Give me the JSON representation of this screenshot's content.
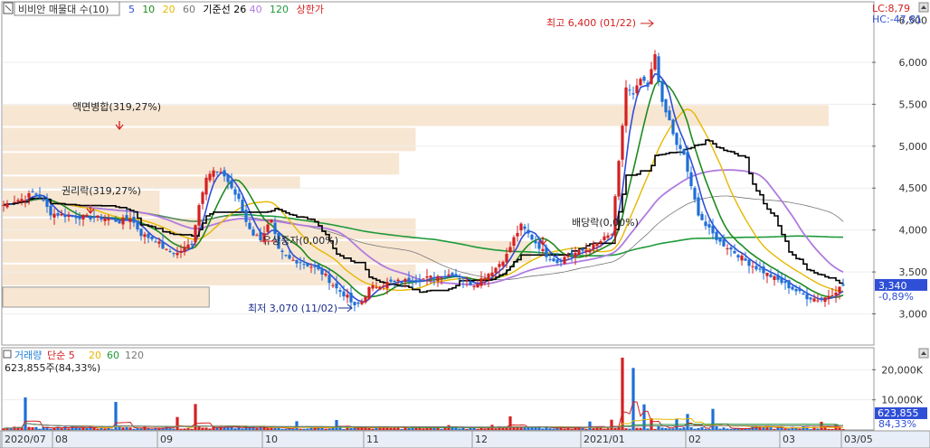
{
  "header": {
    "indicator_name": "비비안 매물대 수(10)",
    "ma": [
      {
        "label": "5",
        "color": "#2f4fd6"
      },
      {
        "label": "10",
        "color": "#1f8a1f"
      },
      {
        "label": "20",
        "color": "#e6b800"
      },
      {
        "label": "60",
        "color": "#777777"
      },
      {
        "label": "기준선 26",
        "color": "#000000"
      },
      {
        "label": "40",
        "color": "#b07be0"
      },
      {
        "label": "120",
        "color": "#1e9a3a"
      },
      {
        "label": "상한가",
        "color": "#d42020"
      }
    ],
    "lc_label": "LC:8,79",
    "hc_label": "HC:-47,81"
  },
  "volume_header": {
    "items": [
      {
        "label": "거래량",
        "color": "#1f7fd6"
      },
      {
        "label": "단순 5",
        "color": "#d42020"
      },
      {
        "label": "20",
        "color": "#e6b800"
      },
      {
        "label": "60",
        "color": "#1e9a3a"
      },
      {
        "label": "120",
        "color": "#777777"
      }
    ],
    "value_line": "623,855주(84,33%)"
  },
  "annotations": {
    "high": "최고 6,400 (01/22)",
    "low": "최저 3,070 (11/02)",
    "events": [
      "액면병합(319,27%)",
      "권리락(319,27%)",
      "유상증자(0,00%)",
      "배당락(0,00%)"
    ]
  },
  "current": {
    "price_tag": "3,340",
    "change_tag": "-0,89%",
    "volume_tag": "623,855",
    "volume_pct_tag": "84,33%"
  },
  "colors": {
    "up": "#d42020",
    "down": "#1f6fd6",
    "volume_profile": "#f7e6d2",
    "tag_bg": "#2f4fd6"
  },
  "chart_data": {
    "type": "candlestick",
    "price_axis": {
      "ylim": [
        2650,
        6700
      ],
      "ticks": [
        3000,
        3500,
        4000,
        4500,
        5000,
        5500,
        6000
      ],
      "tick_labels": [
        "3,000",
        "3,500",
        "4,000",
        "4,500",
        "5,000",
        "5,500",
        "6,000"
      ]
    },
    "volume_axis": {
      "ylim": [
        0,
        27000000
      ],
      "ticks": [
        10000000,
        20000000
      ],
      "tick_labels": [
        "10,000K",
        "20,000K"
      ]
    },
    "x_axis": {
      "labels": [
        "2020/07",
        "08",
        "09",
        "10",
        "11",
        "12",
        "2021/01",
        "02",
        "03",
        "03/05"
      ],
      "label_positions": [
        0,
        14,
        43,
        72,
        100,
        130,
        160,
        189,
        215,
        232
      ]
    },
    "price_path": [
      [
        0,
        4300
      ],
      [
        3,
        4350
      ],
      [
        6,
        4380
      ],
      [
        8,
        4450
      ],
      [
        10,
        4400
      ],
      [
        13,
        4200
      ],
      [
        16,
        4180
      ],
      [
        20,
        4160
      ],
      [
        24,
        4150
      ],
      [
        28,
        4140
      ],
      [
        32,
        4100
      ],
      [
        35,
        4150
      ],
      [
        38,
        3950
      ],
      [
        42,
        3880
      ],
      [
        45,
        3750
      ],
      [
        48,
        3720
      ],
      [
        52,
        3850
      ],
      [
        54,
        4300
      ],
      [
        56,
        4650
      ],
      [
        58,
        4700
      ],
      [
        61,
        4650
      ],
      [
        63,
        4500
      ],
      [
        65,
        4350
      ],
      [
        67,
        4100
      ],
      [
        69,
        3950
      ],
      [
        71,
        3900
      ],
      [
        73,
        4050
      ],
      [
        74,
        4100
      ],
      [
        76,
        3750
      ],
      [
        79,
        3650
      ],
      [
        82,
        3620
      ],
      [
        86,
        3550
      ],
      [
        89,
        3450
      ],
      [
        92,
        3300
      ],
      [
        95,
        3200
      ],
      [
        97,
        3080
      ],
      [
        99,
        3150
      ],
      [
        101,
        3300
      ],
      [
        104,
        3350
      ],
      [
        108,
        3380
      ],
      [
        112,
        3400
      ],
      [
        116,
        3420
      ],
      [
        120,
        3450
      ],
      [
        124,
        3480
      ],
      [
        127,
        3400
      ],
      [
        130,
        3350
      ],
      [
        133,
        3450
      ],
      [
        136,
        3550
      ],
      [
        139,
        3700
      ],
      [
        141,
        3900
      ],
      [
        143,
        4050
      ],
      [
        145,
        3950
      ],
      [
        147,
        3850
      ],
      [
        150,
        3700
      ],
      [
        153,
        3620
      ],
      [
        156,
        3700
      ],
      [
        160,
        3750
      ],
      [
        163,
        3800
      ],
      [
        166,
        3900
      ],
      [
        168,
        3950
      ],
      [
        170,
        4800
      ],
      [
        172,
        5700
      ],
      [
        174,
        5600
      ],
      [
        176,
        5800
      ],
      [
        178,
        5700
      ],
      [
        180,
        6100
      ],
      [
        182,
        5500
      ],
      [
        184,
        5300
      ],
      [
        186,
        5000
      ],
      [
        188,
        4900
      ],
      [
        190,
        4500
      ],
      [
        192,
        4200
      ],
      [
        194,
        4050
      ],
      [
        196,
        3950
      ],
      [
        198,
        3850
      ],
      [
        200,
        3800
      ],
      [
        203,
        3700
      ],
      [
        206,
        3600
      ],
      [
        210,
        3500
      ],
      [
        214,
        3400
      ],
      [
        218,
        3300
      ],
      [
        222,
        3200
      ],
      [
        226,
        3170
      ],
      [
        229,
        3250
      ],
      [
        232,
        3340
      ]
    ],
    "volume_spikes": [
      [
        6,
        10800000
      ],
      [
        31,
        9300000
      ],
      [
        48,
        4300000
      ],
      [
        53,
        8600000
      ],
      [
        81,
        2900000
      ],
      [
        92,
        3300000
      ],
      [
        123,
        1600000
      ],
      [
        135,
        1700000
      ],
      [
        140,
        4500000
      ],
      [
        162,
        2800000
      ],
      [
        168,
        3400000
      ],
      [
        171,
        24000000
      ],
      [
        174,
        20600000
      ],
      [
        177,
        8500000
      ],
      [
        179,
        3900000
      ],
      [
        186,
        3700000
      ],
      [
        189,
        5300000
      ],
      [
        196,
        7000000
      ],
      [
        226,
        2700000
      ],
      [
        230,
        1900000
      ]
    ],
    "volume_profile_bands": [
      [
        5230,
        5500,
        1.0
      ],
      [
        4930,
        5230,
        0.5
      ],
      [
        4650,
        4930,
        0.48
      ],
      [
        4480,
        4650,
        0.36
      ],
      [
        4150,
        4480,
        0.19
      ],
      [
        3880,
        4150,
        0.5
      ],
      [
        3600,
        3880,
        0.64
      ],
      [
        3330,
        3600,
        0.5
      ],
      [
        3070,
        3330,
        0.25
      ]
    ],
    "current_price": 3340,
    "current_change_pct": -0.89,
    "current_volume": 623855,
    "current_volume_pct": 84.33
  }
}
